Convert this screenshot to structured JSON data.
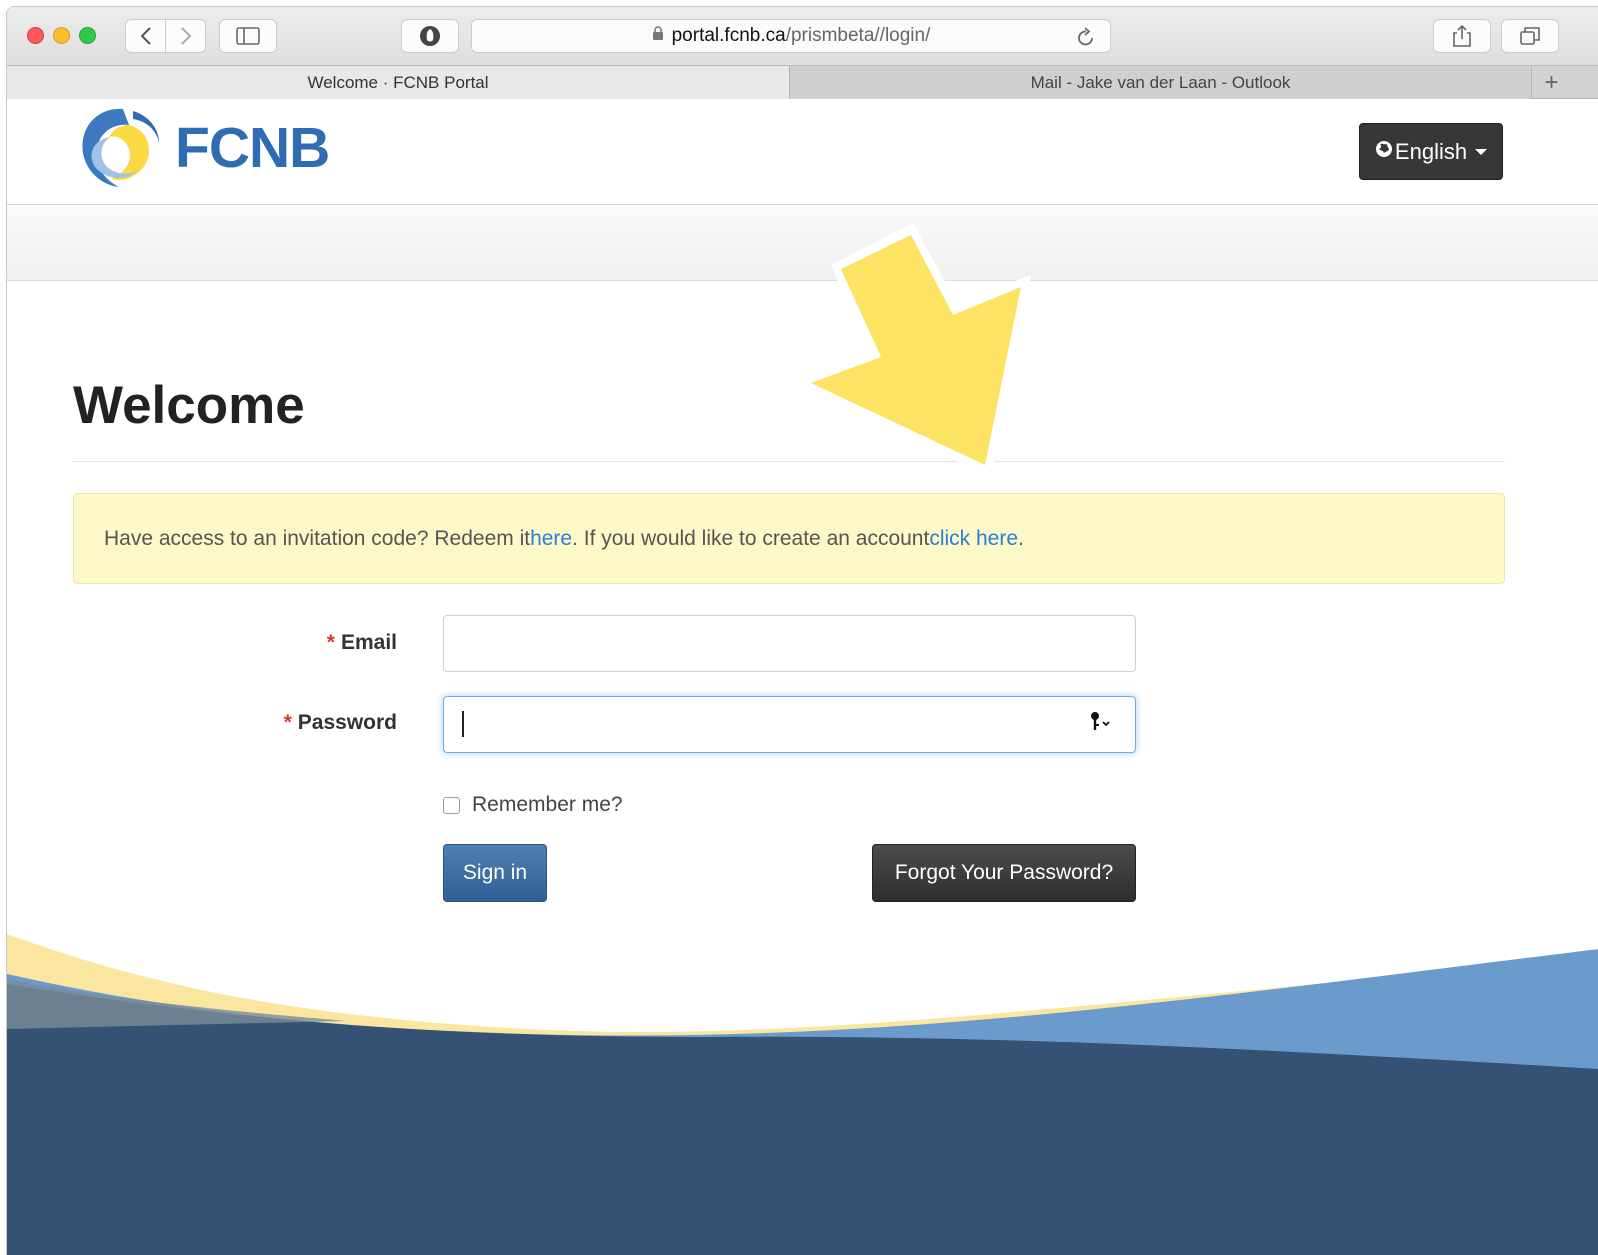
{
  "browser": {
    "address": {
      "domain": "portal.fcnb.ca",
      "path": "/prismbeta//login/"
    },
    "tabs": [
      {
        "label": "Welcome  · FCNB Portal",
        "active": true
      },
      {
        "label": "Mail - Jake van der Laan - Outlook",
        "active": false
      }
    ],
    "add_tab_label": "+"
  },
  "header": {
    "logo_text": "FCNB",
    "language_button": "English"
  },
  "main": {
    "title": "Welcome",
    "alert": {
      "text_1": "Have access to an invitation code? Redeem it ",
      "link_1": "here",
      "text_2": ". If you would like to create an account ",
      "link_2": "click here",
      "text_3": "."
    },
    "form": {
      "email_label": "Email",
      "password_label": "Password",
      "required_marker": "*",
      "email_value": "",
      "password_value": "",
      "remember_label": "Remember me?",
      "sign_in_label": "Sign in",
      "forgot_label": "Forgot Your Password?"
    }
  },
  "colors": {
    "brand_blue": "#2e6db3",
    "brand_yellow": "#fbe36a",
    "link_blue": "#2b7fd6",
    "alert_bg": "#fcf8c7",
    "footer_navy": "#355275"
  },
  "icons": [
    "lock-icon",
    "reload-icon",
    "share-icon",
    "tabs-overview-icon",
    "sidebar-icon",
    "shield-icon",
    "globe-icon",
    "key-icon",
    "annotation-arrow"
  ]
}
